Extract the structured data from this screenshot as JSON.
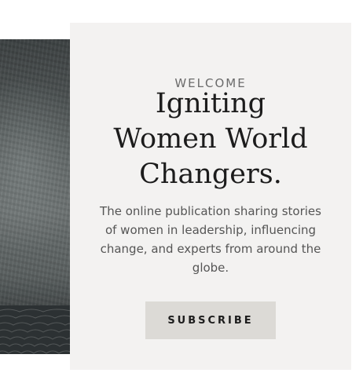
{
  "hero": {
    "eyebrow": "WELCOME",
    "headline_line1": "Igniting",
    "headline_line2": "Women World",
    "headline_line3": "Changers.",
    "description": "The online publication sharing stories of women in leadership, influencing change, and experts from around the globe.",
    "subscribe_label": "SUBSCRIBE"
  },
  "colors": {
    "card_background": "#f3f2f1",
    "button_background": "#dcdad6",
    "heading_text": "#1c1c1c",
    "body_text": "#555555"
  }
}
